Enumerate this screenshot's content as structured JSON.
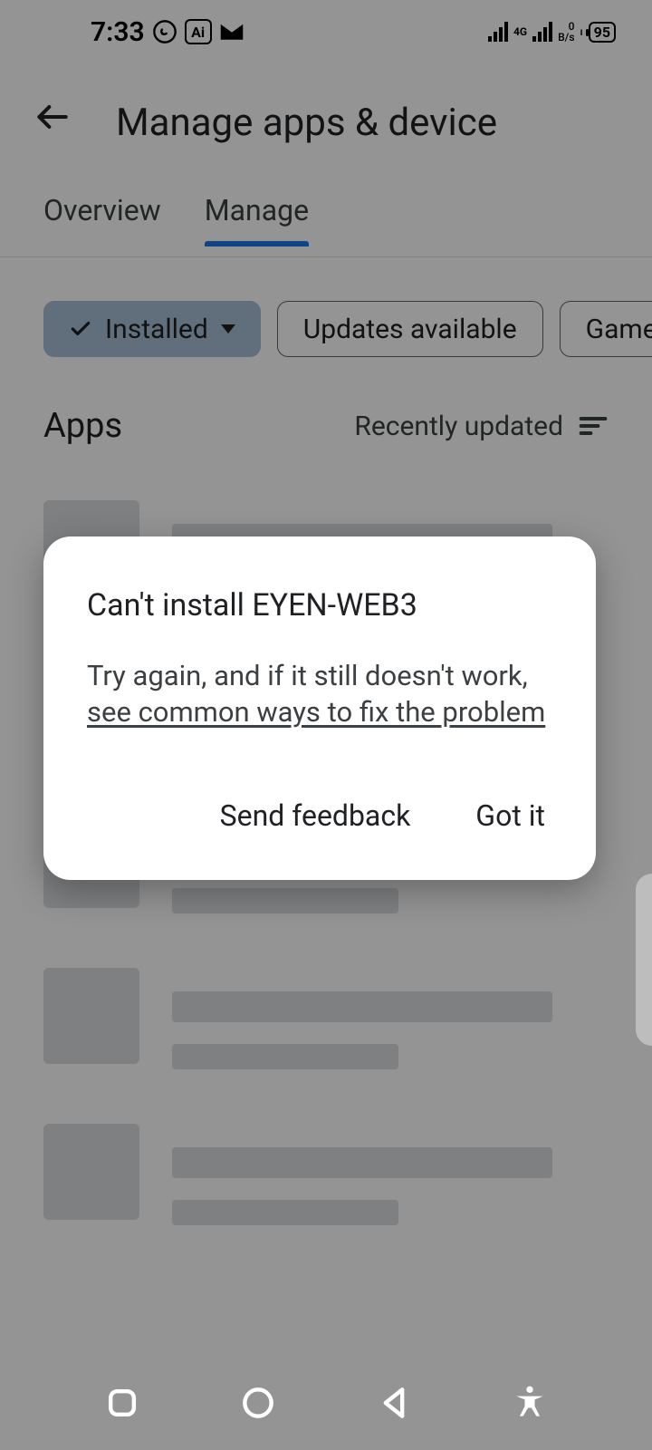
{
  "statusbar": {
    "time": "7:33",
    "ai_label": "Ai",
    "network_label": "4G",
    "data_rate_top": "0",
    "data_rate_bottom": "B/s",
    "battery": "95"
  },
  "header": {
    "title": "Manage apps & device"
  },
  "tabs": [
    {
      "label": "Overview",
      "active": false
    },
    {
      "label": "Manage",
      "active": true
    }
  ],
  "chips": {
    "installed": "Installed",
    "updates": "Updates available",
    "games": "Games"
  },
  "section": {
    "title": "Apps",
    "sort_label": "Recently updated"
  },
  "dialog": {
    "title": "Can't install EYEN-WEB3",
    "body_prefix": "Try again, and if it still doesn't work, ",
    "body_link": "see common ways to fix the problem",
    "actions": {
      "feedback": "Send feedback",
      "ok": "Got it"
    }
  }
}
